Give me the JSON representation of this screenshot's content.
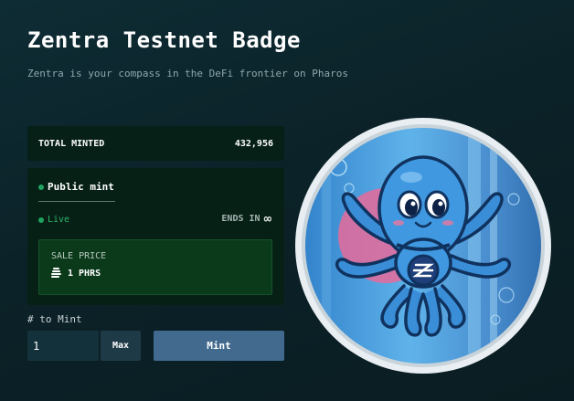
{
  "page": {
    "title": "Zentra Testnet Badge",
    "subtitle": "Zentra is your compass in the DeFi frontier on Pharos"
  },
  "minted": {
    "label": "TOTAL MINTED",
    "value": "432,956"
  },
  "mint_panel": {
    "tab_label": "Public mint",
    "status": "Live",
    "ends_label": "ENDS IN",
    "ends_value_icon": "infinity-icon",
    "sale_price_label": "SALE PRICE",
    "sale_price_value": "1 PHRS",
    "currency_icon": "pharos-icon"
  },
  "controls": {
    "qty_label": "# to Mint",
    "qty_value": "1",
    "max_label": "Max",
    "mint_label": "Mint"
  },
  "colors": {
    "accent_green": "#1fa35f",
    "mint_button": "#426a8e",
    "badge_background": "#4a9fd9",
    "octopus": "#3a8ed8"
  },
  "badge": {
    "image_icon": "octopus-mascot-icon",
    "emblem_icon": "zentra-z-logo-icon"
  }
}
